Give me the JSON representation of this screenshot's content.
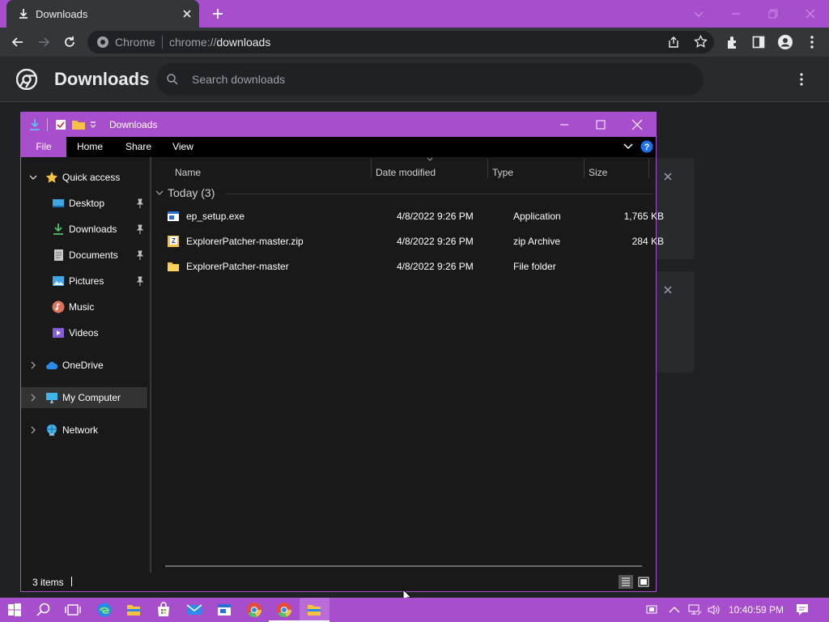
{
  "browser": {
    "tab_title": "Downloads",
    "omnibox_chip": "Chrome",
    "url_scheme": "chrome://",
    "url_path": "downloads"
  },
  "downloads_page": {
    "title": "Downloads",
    "search_placeholder": "Search downloads"
  },
  "explorer": {
    "title": "Downloads",
    "ribbon_tabs": [
      "File",
      "Home",
      "Share",
      "View"
    ],
    "nav": [
      {
        "label": "Quick access",
        "icon": "star-icon",
        "level": 0,
        "expanded": true
      },
      {
        "label": "Desktop",
        "icon": "desktop-icon",
        "level": 1,
        "pinned": true
      },
      {
        "label": "Downloads",
        "icon": "download-icon",
        "level": 1,
        "pinned": true
      },
      {
        "label": "Documents",
        "icon": "documents-icon",
        "level": 1,
        "pinned": true
      },
      {
        "label": "Pictures",
        "icon": "pictures-icon",
        "level": 1,
        "pinned": true
      },
      {
        "label": "Music",
        "icon": "music-icon",
        "level": 1
      },
      {
        "label": "Videos",
        "icon": "videos-icon",
        "level": 1
      },
      {
        "label": "OneDrive",
        "icon": "cloud-icon",
        "level": 0
      },
      {
        "label": "My Computer",
        "icon": "computer-icon",
        "level": 0,
        "selected": true
      },
      {
        "label": "Network",
        "icon": "network-icon",
        "level": 0
      }
    ],
    "columns": [
      "Name",
      "Date modified",
      "Type",
      "Size"
    ],
    "group_label": "Today (3)",
    "files": [
      {
        "name": "ep_setup.exe",
        "date": "4/8/2022 9:26 PM",
        "type": "Application",
        "size": "1,765 KB",
        "icon": "exe-icon"
      },
      {
        "name": "ExplorerPatcher-master.zip",
        "date": "4/8/2022 9:26 PM",
        "type": "zip Archive",
        "size": "284 KB",
        "icon": "zip-icon"
      },
      {
        "name": "ExplorerPatcher-master",
        "date": "4/8/2022 9:26 PM",
        "type": "File folder",
        "size": "",
        "icon": "folder-icon"
      }
    ],
    "status": "3 items"
  },
  "taskbar": {
    "clock": "10:40:59 PM"
  },
  "colors": {
    "accent": "#a64ecb",
    "chrome_dark": "#35363a",
    "explorer_bg": "#191919"
  }
}
